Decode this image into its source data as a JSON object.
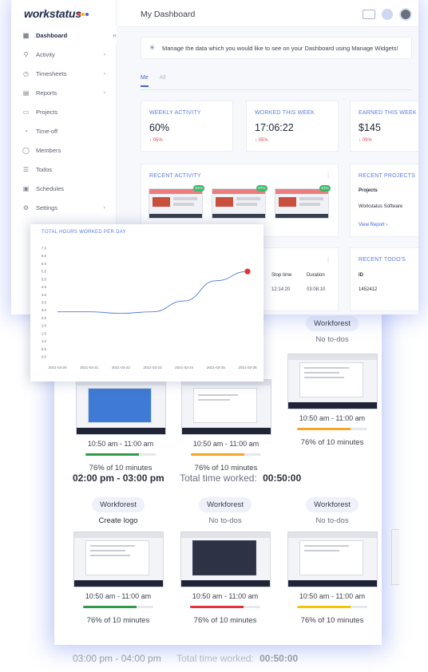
{
  "brand": {
    "name": "workstatus",
    "dot_colors": [
      "#e84b4b",
      "#f5b400",
      "#3f67d8"
    ]
  },
  "sidebar": {
    "collapse_icon": "double-chevron-left-icon",
    "items": [
      {
        "label": "Dashboard",
        "icon": "grid-icon",
        "active": true,
        "has_chevron": false
      },
      {
        "label": "Activity",
        "icon": "activity-icon",
        "active": false,
        "has_chevron": true
      },
      {
        "label": "Timesheets",
        "icon": "clock-icon",
        "active": false,
        "has_chevron": true
      },
      {
        "label": "Reports",
        "icon": "report-icon",
        "active": false,
        "has_chevron": true
      },
      {
        "label": "Projects",
        "icon": "folder-icon",
        "active": false,
        "has_chevron": false
      },
      {
        "label": "Time-off",
        "icon": "calendar-off-icon",
        "active": false,
        "has_chevron": false
      },
      {
        "label": "Members",
        "icon": "user-icon",
        "active": false,
        "has_chevron": false
      },
      {
        "label": "Todos",
        "icon": "checklist-icon",
        "active": false,
        "has_chevron": false
      },
      {
        "label": "Schedules",
        "icon": "schedule-icon",
        "active": false,
        "has_chevron": false
      },
      {
        "label": "Settings",
        "icon": "gear-icon",
        "active": false,
        "has_chevron": true
      }
    ]
  },
  "header": {
    "title": "My Dashboard"
  },
  "banner": {
    "icon": "lightbulb-icon",
    "text": "Manage the data which you would like to see on your Dashboard using Manage Widgets!"
  },
  "tabs": [
    {
      "label": "Me",
      "active": true
    },
    {
      "label": "All",
      "active": false
    }
  ],
  "stats": [
    {
      "title": "WEEKLY ACTIVITY",
      "value": "60%",
      "delta": "↓ 05%"
    },
    {
      "title": "WORKED THIS WEEK",
      "value": "17:06:22",
      "delta": "↓ 05%"
    },
    {
      "title": "EARNED THIS WEEK",
      "value": "$145",
      "delta": "↓ 05%"
    }
  ],
  "recent_activity": {
    "title": "RECENT ACTIVITY",
    "badges": [
      "61%",
      "67%",
      "61%"
    ]
  },
  "recent_projects": {
    "title": "RECENT PROJECTS",
    "header": "Projects",
    "row": "Workstatus Software",
    "link": "View Report ›"
  },
  "time_table": {
    "columns": [
      "Stop time",
      "Duration"
    ],
    "row": [
      "12:14:20",
      "03:08:10"
    ]
  },
  "recent_todos": {
    "title": "RECENT TODO'S",
    "header": "ID",
    "row": "1452412"
  },
  "chart_data": {
    "type": "line",
    "title": "TOTAL HOURS WORKED PER DAY",
    "x": [
      "2021-03-20",
      "2021-03-21",
      "2021-03-22",
      "2021-03-23",
      "2021-03-24",
      "2021-03-25",
      "2021-03-26"
    ],
    "y_ticks": [
      "0.0",
      "0.5",
      "1.0",
      "1.5",
      "2.0",
      "2.5",
      "3.0",
      "3.5",
      "4.0",
      "4.5",
      "5.0",
      "5.5",
      "6.0",
      "6.5",
      "7.0"
    ],
    "ylim": [
      0,
      7
    ],
    "series": [
      {
        "values": [
          2.9,
          2.9,
          2.8,
          2.9,
          3.6,
          4.9,
          5.5
        ]
      }
    ],
    "line_color": "#4f7bd8",
    "highlight_point_color": "#e0353a"
  },
  "shots": {
    "groups_top": [
      {
        "project": "",
        "todo": "",
        "time": "10:50 am - 11:00 am",
        "percent_text": "76% of 10 minutes",
        "fill": 0.76,
        "bar_color": "#2e9a4a",
        "thumb": "blue"
      },
      {
        "project": "",
        "todo": "",
        "time": "10:50 am - 11:00 am",
        "percent_text": "76% of 10 minutes",
        "fill": 0.76,
        "bar_color": "#f5a623",
        "thumb": "light"
      },
      {
        "project": "Workforest",
        "todo": "No to-dos",
        "time": "10:50 am - 11:00 am",
        "percent_text": "76% of 10 minutes",
        "fill": 0.76,
        "bar_color": "#f5a623",
        "thumb": "light"
      }
    ],
    "slot": {
      "range": "02:00 pm - 03:00 pm",
      "label": "Total time worked:",
      "value": "00:50:00"
    },
    "groups_bottom": [
      {
        "project": "Workforest",
        "todo": "Create logo",
        "time": "10:50 am - 11:00 am",
        "percent_text": "76% of 10 minutes",
        "fill": 0.76,
        "bar_color": "#2e9a4a",
        "thumb": "light"
      },
      {
        "project": "Workforest",
        "todo": "No to-dos",
        "time": "10:50 am - 11:00 am",
        "percent_text": "76% of 10 minutes",
        "fill": 0.76,
        "bar_color": "#e0353a",
        "thumb": "dark"
      },
      {
        "project": "Workforest",
        "todo": "No to-dos",
        "time": "10:50 am - 11:00 am",
        "percent_text": "76% of 10 minutes",
        "fill": 0.76,
        "bar_color": "#f5c400",
        "thumb": "light"
      }
    ],
    "next_slot": {
      "range": "03:00 pm - 04:00 pm",
      "label": "Total time worked:",
      "value": "00:50:00"
    }
  }
}
